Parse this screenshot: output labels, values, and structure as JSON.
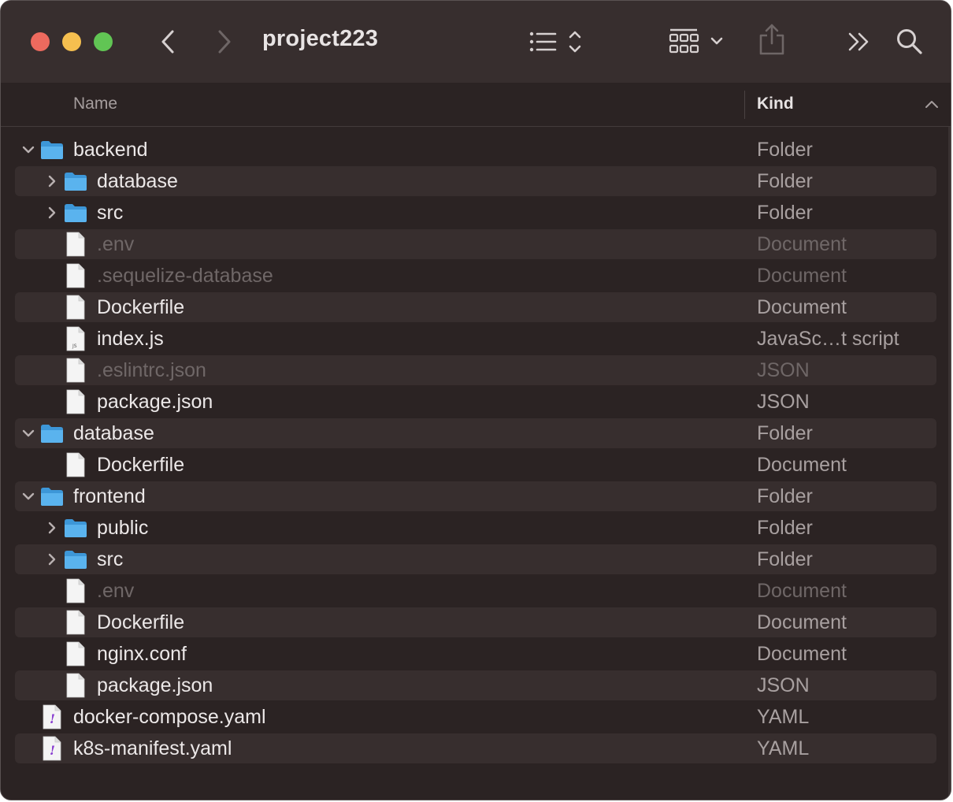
{
  "window": {
    "title": "project223",
    "traffic_lights": {
      "close": "#ed6a5e",
      "minimize": "#f5bf4f",
      "zoom": "#61c554"
    }
  },
  "toolbar": {
    "icons": [
      "back-chevron-icon",
      "forward-chevron-icon",
      "list-view-icon",
      "group-by-icon",
      "share-icon",
      "more-icon",
      "search-icon"
    ]
  },
  "columns": {
    "name": "Name",
    "kind": "Kind",
    "sort": "ascending"
  },
  "rows": [
    {
      "name": "backend",
      "kind": "Folder",
      "depth": 0,
      "type": "folder",
      "expanded": true,
      "dim": false
    },
    {
      "name": "database",
      "kind": "Folder",
      "depth": 1,
      "type": "folder",
      "expanded": false,
      "dim": false
    },
    {
      "name": "src",
      "kind": "Folder",
      "depth": 1,
      "type": "folder",
      "expanded": false,
      "dim": false
    },
    {
      "name": ".env",
      "kind": "Document",
      "depth": 1,
      "type": "doc",
      "dim": true
    },
    {
      "name": ".sequelize-database",
      "kind": "Document",
      "depth": 1,
      "type": "doc",
      "dim": true
    },
    {
      "name": "Dockerfile",
      "kind": "Document",
      "depth": 1,
      "type": "doc",
      "dim": false
    },
    {
      "name": "index.js",
      "kind": "JavaSc…t script",
      "depth": 1,
      "type": "js",
      "dim": false
    },
    {
      "name": ".eslintrc.json",
      "kind": "JSON",
      "depth": 1,
      "type": "json",
      "dim": true
    },
    {
      "name": "package.json",
      "kind": "JSON",
      "depth": 1,
      "type": "json",
      "dim": false
    },
    {
      "name": "database",
      "kind": "Folder",
      "depth": 0,
      "type": "folder",
      "expanded": true,
      "dim": false
    },
    {
      "name": "Dockerfile",
      "kind": "Document",
      "depth": 1,
      "type": "doc",
      "dim": false
    },
    {
      "name": "frontend",
      "kind": "Folder",
      "depth": 0,
      "type": "folder",
      "expanded": true,
      "dim": false
    },
    {
      "name": "public",
      "kind": "Folder",
      "depth": 1,
      "type": "folder",
      "expanded": false,
      "dim": false
    },
    {
      "name": "src",
      "kind": "Folder",
      "depth": 1,
      "type": "folder",
      "expanded": false,
      "dim": false
    },
    {
      "name": ".env",
      "kind": "Document",
      "depth": 1,
      "type": "doc",
      "dim": true
    },
    {
      "name": "Dockerfile",
      "kind": "Document",
      "depth": 1,
      "type": "doc",
      "dim": false
    },
    {
      "name": "nginx.conf",
      "kind": "Document",
      "depth": 1,
      "type": "doc",
      "dim": false
    },
    {
      "name": "package.json",
      "kind": "JSON",
      "depth": 1,
      "type": "json",
      "dim": false
    },
    {
      "name": "docker-compose.yaml",
      "kind": "YAML",
      "depth": 0,
      "type": "yaml",
      "dim": false
    },
    {
      "name": "k8s-manifest.yaml",
      "kind": "YAML",
      "depth": 0,
      "type": "yaml",
      "dim": false
    }
  ],
  "colors": {
    "background": "#2b2323",
    "stripe": "#372e2e",
    "folder": "#5ab3ee",
    "text": "#ece8e8",
    "dim_text": "#6f6767"
  }
}
